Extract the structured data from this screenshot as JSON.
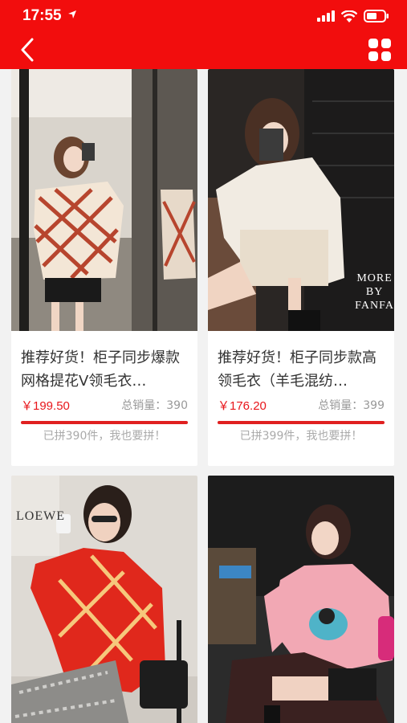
{
  "status": {
    "time": "17:55"
  },
  "products": [
    {
      "title": "推荐好货！柜子同步爆款网格提花V领毛衣…",
      "price": "￥199.50",
      "sales_label": "总销量：390",
      "cta": "已拼390件，我也要拼！"
    },
    {
      "title": "推荐好货！柜子同步款高领毛衣（羊毛混纺…",
      "price": "￥176.20",
      "sales_label": "总销量：399",
      "cta": "已拼399件，我也要拼！",
      "photo_text": [
        "MORE",
        "BY",
        "FANFA"
      ]
    },
    {
      "photo_text": [
        "LOEWE"
      ]
    },
    {}
  ],
  "colors": {
    "header": "#f20d0d",
    "price": "#e8161b",
    "bar": "#e02020"
  }
}
